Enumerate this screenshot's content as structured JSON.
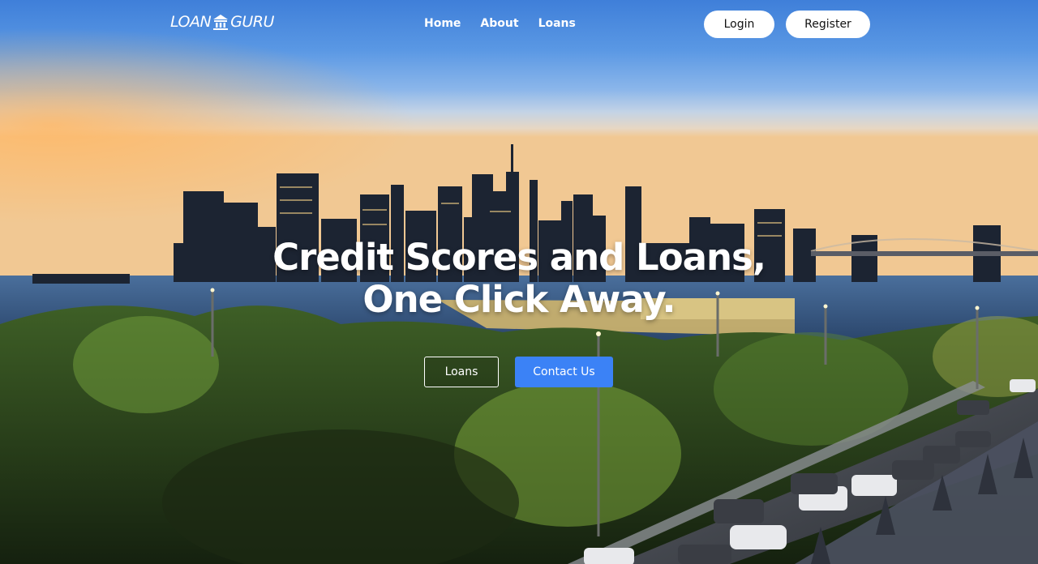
{
  "brand": {
    "logo_left": "LOAN",
    "logo_right": "GURU",
    "logo_icon": "bank-icon"
  },
  "nav": {
    "items": [
      {
        "label": "Home"
      },
      {
        "label": "About"
      },
      {
        "label": "Loans"
      }
    ]
  },
  "auth": {
    "login_label": "Login",
    "register_label": "Register"
  },
  "hero": {
    "headline_line1": "Credit Scores and Loans,",
    "headline_line2": "One Click Away.",
    "loans_button": "Loans",
    "contact_button": "Contact Us"
  },
  "colors": {
    "primary_button": "#3b82f6",
    "pill_button_bg": "#ffffff",
    "text": "#ffffff"
  }
}
